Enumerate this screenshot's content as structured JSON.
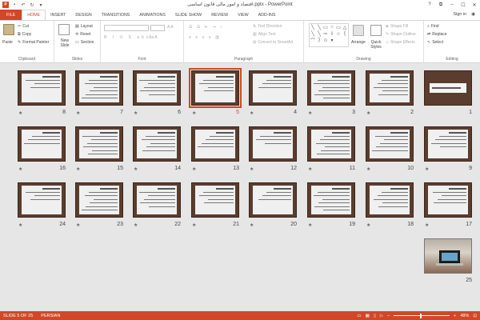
{
  "window": {
    "title": "اقتصاد و امور مالی قانون اساسی.pptx - PowerPoint",
    "controls": [
      "?",
      "⧉",
      "–",
      "☐",
      "✕"
    ]
  },
  "qat": {
    "app": "P",
    "save": "💾",
    "undo": "↶",
    "redo": "↻",
    "customize": "▾"
  },
  "tabs": [
    {
      "label": "FILE",
      "kind": "file"
    },
    {
      "label": "HOME",
      "kind": "active"
    },
    {
      "label": "INSERT"
    },
    {
      "label": "DESIGN"
    },
    {
      "label": "TRANSITIONS"
    },
    {
      "label": "ANIMATIONS"
    },
    {
      "label": "SLIDE SHOW"
    },
    {
      "label": "REVIEW"
    },
    {
      "label": "VIEW"
    },
    {
      "label": "ADD-INS"
    }
  ],
  "signin": "Sign in",
  "ribbon": {
    "clipboard": {
      "label": "Clipboard",
      "paste": "Paste",
      "cut": "Cut",
      "copy": "Copy",
      "format_painter": "Format Painter"
    },
    "slides": {
      "label": "Slides",
      "new_slide": "New Slide",
      "layout": "Layout",
      "reset": "Reset",
      "section": "Section"
    },
    "font": {
      "label": "Font"
    },
    "paragraph": {
      "label": "Paragraph",
      "text_direction": "Text Direction",
      "align_text": "Align Text",
      "convert_smartart": "Convert to SmartArt"
    },
    "drawing": {
      "label": "Drawing",
      "arrange": "Arrange",
      "quick_styles": "Quick Styles",
      "shape_fill": "Shape Fill",
      "shape_outline": "Shape Outline",
      "shape_effects": "Shape Effects"
    },
    "editing": {
      "label": "Editing",
      "find": "Find",
      "replace": "Replace",
      "select": "Select"
    }
  },
  "slides": {
    "selected": 5,
    "numbers": [
      "1",
      "2",
      "3",
      "4",
      "5",
      "6",
      "7",
      "8",
      "9",
      "10",
      "11",
      "12",
      "13",
      "14",
      "15",
      "16",
      "17",
      "18",
      "19",
      "20",
      "21",
      "22",
      "23",
      "24",
      "25"
    ],
    "star": "★"
  },
  "status": {
    "slide_info": "SLIDE 5 OF 25",
    "language": "PERSIAN",
    "zoom": "48%",
    "zoom_fraction": 0.48
  },
  "colors": {
    "accent": "#d24726",
    "slide_frame": "#5a3d2e"
  }
}
